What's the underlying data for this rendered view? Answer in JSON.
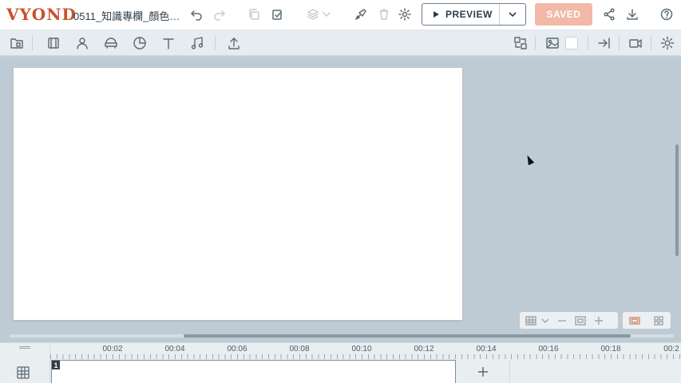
{
  "app": {
    "logo_text": "VYOND",
    "document_title": "0511_知識專欄_顏色…"
  },
  "header": {
    "preview_label": "PREVIEW",
    "saved_label": "SAVED"
  },
  "timeline": {
    "ticks": [
      "00:02",
      "00:04",
      "00:06",
      "00:08",
      "00:10",
      "00:12",
      "00:14",
      "00:16",
      "00:18",
      "00:2"
    ],
    "scene_number": "1"
  },
  "colors": {
    "brand": "#c8502f",
    "saved_button": "#f2b8a8",
    "workspace": "#bfcbd4",
    "canvas": "#ffffff"
  }
}
